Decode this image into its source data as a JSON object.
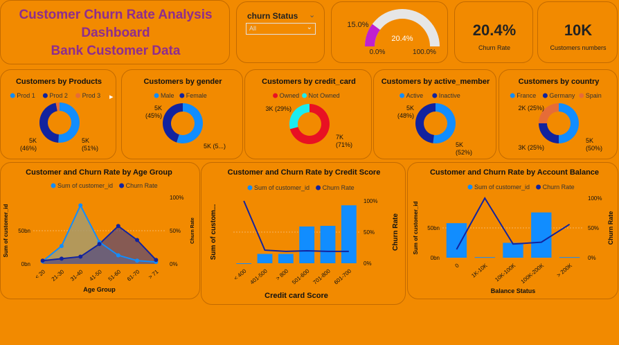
{
  "title": {
    "line1": "Customer Churn Rate Analysis",
    "line2": "Dashboard",
    "line3": "Bank Customer Data"
  },
  "slicer": {
    "label": "churn Status",
    "value": "All"
  },
  "gauge": {
    "value_pct": 20.4,
    "value_label": "20.4%",
    "target_label": "15.0%",
    "min_label": "0.0%",
    "max_label": "100.0%",
    "fill_color": "#c020d0",
    "track_color": "#e6e6e6"
  },
  "kpis": [
    {
      "value": "20.4%",
      "label": "Churn Rate"
    },
    {
      "value": "10K",
      "label": "Customers numbers"
    }
  ],
  "colors": {
    "blue": "#118dff",
    "navy": "#12239e",
    "salmon": "#e66c37",
    "red": "#e81123",
    "cyan": "#1aedf0"
  },
  "chart_data": [
    {
      "type": "pie",
      "title": "Customers by Products",
      "legend": [
        "Prod 1",
        "Prod 2",
        "Prod 3"
      ],
      "colors": [
        "#118dff",
        "#12239e",
        "#e66c37"
      ],
      "values": [
        5100,
        4600,
        300
      ],
      "labels": [
        "5K\n(51%)",
        "5K\n(46%)",
        ""
      ]
    },
    {
      "type": "pie",
      "title": "Customers by gender",
      "legend": [
        "Male",
        "Female"
      ],
      "colors": [
        "#118dff",
        "#12239e"
      ],
      "values": [
        5500,
        4500
      ],
      "labels": [
        "5K (5...)",
        "5K\n(45%)"
      ]
    },
    {
      "type": "pie",
      "title": "Customers by credit_card",
      "legend": [
        "Owned",
        "Not Owned"
      ],
      "colors": [
        "#e81123",
        "#1aedf0"
      ],
      "values": [
        7100,
        2900
      ],
      "labels": [
        "7K\n(71%)",
        "3K (29%)"
      ]
    },
    {
      "type": "pie",
      "title": "Customers by active_member",
      "legend": [
        "Active",
        "Inactive"
      ],
      "colors": [
        "#118dff",
        "#12239e"
      ],
      "values": [
        5200,
        4800
      ],
      "labels": [
        "5K\n(52%)",
        "5K\n(48%)"
      ]
    },
    {
      "type": "pie",
      "title": "Customers by country",
      "legend": [
        "France",
        "Germany",
        "Spain"
      ],
      "colors": [
        "#118dff",
        "#12239e",
        "#e66c37"
      ],
      "values": [
        5000,
        2500,
        2500
      ],
      "labels": [
        "5K\n(50%)",
        "3K (25%)",
        "2K (25%)"
      ]
    },
    {
      "type": "area",
      "title": "Customer and Churn Rate by Age Group",
      "legend": [
        "Sum of customer_id",
        "Churn Rate"
      ],
      "categories": [
        "< 20",
        "21-30",
        "31-40",
        "41-50",
        "51-60",
        "61-70",
        "> 71"
      ],
      "series": [
        {
          "name": "Sum of customer_id",
          "values": [
            4,
            27,
            88,
            33,
            13,
            5,
            3
          ]
        },
        {
          "name": "Churn Rate",
          "values": [
            5,
            8,
            11,
            30,
            57,
            36,
            6
          ]
        }
      ],
      "xlabel": "Age Group",
      "ylabel": "Sum of customer_id",
      "y2label": "Churn Rate",
      "yticks": [
        "0bn",
        "50bn"
      ],
      "y2ticks": [
        "0%",
        "50%",
        "100%"
      ],
      "ylim": [
        0,
        100
      ],
      "y2lim": [
        0,
        100
      ]
    },
    {
      "type": "bar",
      "title": "Customer and Churn Rate by Credit Score",
      "legend": [
        "Sum of customer_id",
        "Churn Rate"
      ],
      "categories": [
        "< 400",
        "401-500",
        "> 800",
        "501-600",
        "701-800",
        "601-700"
      ],
      "series": [
        {
          "name": "Sum of customer_id",
          "values": [
            0,
            15,
            15,
            59,
            60,
            93
          ]
        },
        {
          "name": "Churn Rate",
          "values": [
            100,
            21,
            19,
            20,
            19,
            19
          ]
        }
      ],
      "xlabel": "Credit card Score",
      "ylabel": "Sum of custom...",
      "y2label": "Churn Rate",
      "y2ticks": [
        "0%",
        "50%",
        "100%"
      ],
      "ylim": [
        0,
        100
      ],
      "y2lim": [
        0,
        100
      ]
    },
    {
      "type": "bar",
      "title": "Customer and Churn Rate by Account Balance",
      "legend": [
        "Sum of customer_id",
        "Churn Rate"
      ],
      "categories": [
        "0",
        "1K-10K",
        "10K-100K",
        "100K-200K",
        "> 200K"
      ],
      "series": [
        {
          "name": "Sum of customer_id",
          "values": [
            58,
            1,
            25,
            76,
            1
          ]
        },
        {
          "name": "Churn Rate",
          "values": [
            14,
            100,
            23,
            26,
            56
          ]
        }
      ],
      "xlabel": "Balance Status",
      "ylabel": "Sum of customer_id",
      "y2label": "Churn Rate",
      "yticks": [
        "0bn",
        "50bn"
      ],
      "y2ticks": [
        "0%",
        "50%",
        "100%"
      ],
      "ylim": [
        0,
        100
      ],
      "y2lim": [
        0,
        100
      ]
    }
  ]
}
